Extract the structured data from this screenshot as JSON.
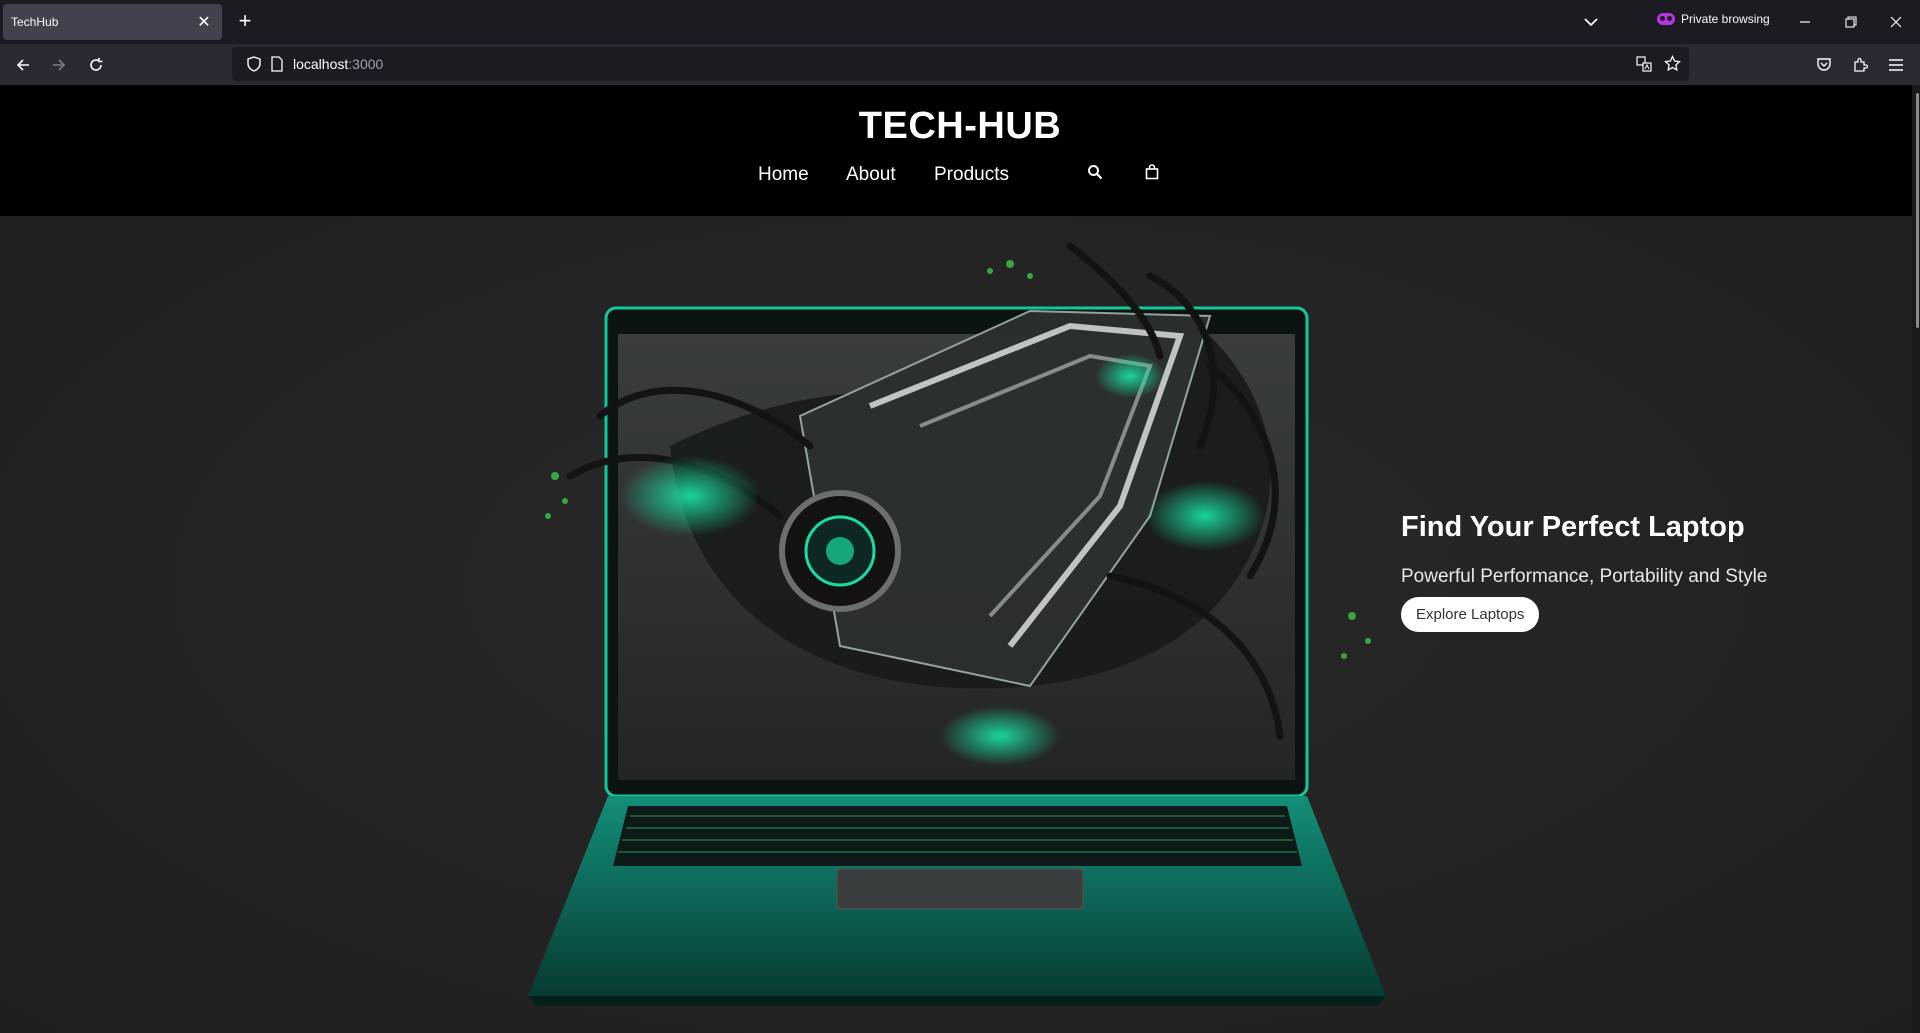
{
  "browser": {
    "tab_title": "TechHub",
    "tab_close_glyph": "✕",
    "new_tab_glyph": "+",
    "private_label": "Private browsing",
    "url_host": "localhost",
    "url_port": ":3000",
    "icons": [
      "chevron-down-icon",
      "minimize-icon",
      "restore-icon",
      "close-icon",
      "back-icon",
      "forward-icon",
      "reload-icon",
      "shield-icon",
      "page-icon",
      "translate-icon",
      "bookmark-star-icon",
      "pocket-icon",
      "extensions-icon",
      "menu-icon"
    ]
  },
  "site": {
    "logo": "TECH-HUB",
    "nav": [
      {
        "label": "Home"
      },
      {
        "label": "About"
      },
      {
        "label": "Products"
      }
    ],
    "icons": [
      "search-icon",
      "shopping-bag-icon"
    ]
  },
  "hero": {
    "title": "Find Your Perfect Laptop",
    "subtitle": "Powerful Performance, Portability and Style",
    "cta": "Explore Laptops",
    "art_accent": "#19e6a8",
    "art_frame": "#0f8f74"
  },
  "colors": {
    "header_bg": "#000000",
    "hero_bg": "#222222",
    "accent_green": "#19e6a8"
  }
}
